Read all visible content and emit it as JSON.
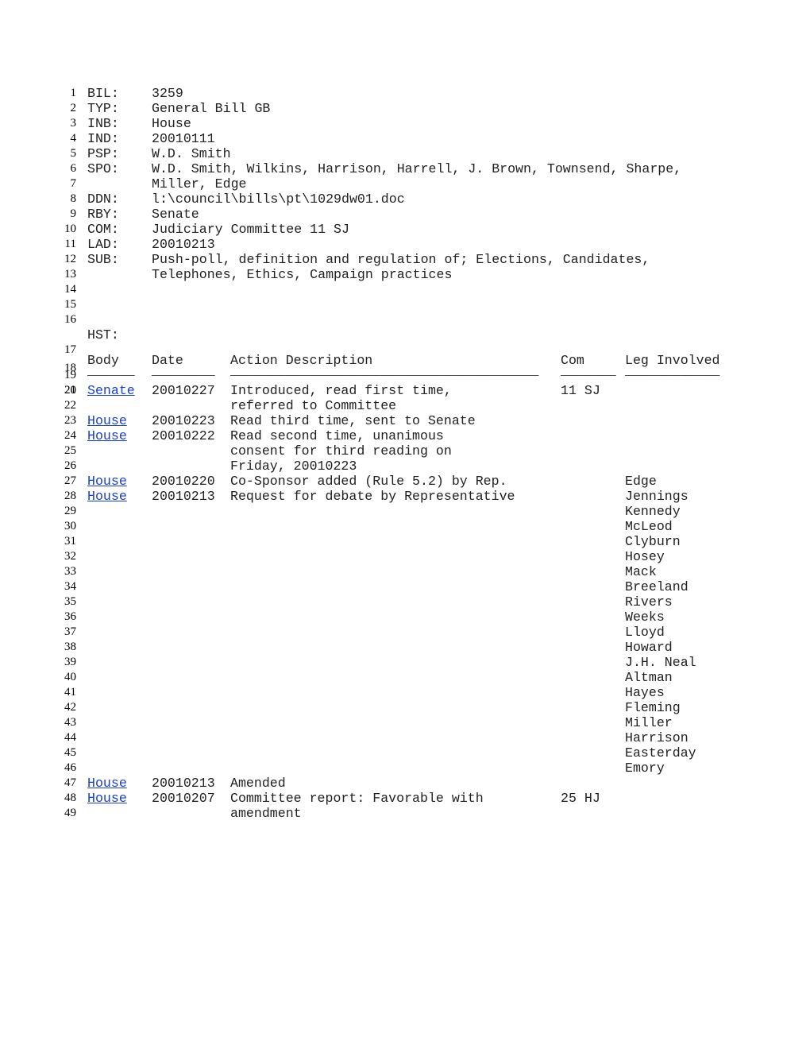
{
  "header_fields": [
    {
      "line": "1",
      "key": "BIL:",
      "value": "3259"
    },
    {
      "line": "2",
      "key": "TYP:",
      "value": "General Bill GB"
    },
    {
      "line": "3",
      "key": "INB:",
      "value": "House"
    },
    {
      "line": "4",
      "key": "IND:",
      "value": "20010111"
    },
    {
      "line": "5",
      "key": "PSP:",
      "value": "W.D. Smith"
    },
    {
      "line": "6",
      "key": "SPO:",
      "value": "W.D. Smith, Wilkins, Harrison, Harrell, J. Brown, Townsend, Sharpe,"
    },
    {
      "line": "7",
      "key": "",
      "value": "Miller, Edge"
    },
    {
      "line": "8",
      "key": "DDN:",
      "value": "l:\\council\\bills\\pt\\1029dw01.doc"
    },
    {
      "line": "9",
      "key": "RBY:",
      "value": "Senate"
    },
    {
      "line": "10",
      "key": "COM:",
      "value": "Judiciary Committee 11 SJ"
    },
    {
      "line": "11",
      "key": "LAD:",
      "value": "20010213"
    },
    {
      "line": "12",
      "key": "SUB:",
      "value": "Push-poll, definition and regulation of; Elections, Candidates,"
    },
    {
      "line": "13",
      "key": "",
      "value": "Telephones, Ethics, Campaign practices"
    }
  ],
  "blank_lines": [
    "14",
    "15",
    "16"
  ],
  "hst": {
    "line": "17",
    "label": "HST:"
  },
  "blank_line_18": "18",
  "history_header": {
    "line": "19",
    "body": "Body",
    "date": "Date",
    "action": "Action Description",
    "com": "Com",
    "leg": "Leg Involved"
  },
  "separator": {
    "line": "20",
    "body": "______",
    "date": "________",
    "action": "_______________________________________",
    "com": "_______",
    "leg": "____________"
  },
  "history_rows": [
    {
      "line": "21",
      "body": "Senate",
      "date": "20010227",
      "action": "Introduced, read first time,",
      "com": "11 SJ",
      "leg": ""
    },
    {
      "line": "22",
      "body": "",
      "date": "",
      "action": "referred to Committee",
      "com": "",
      "leg": ""
    },
    {
      "line": "23",
      "body": "House",
      "date": "20010223",
      "action": "Read third time, sent to Senate",
      "com": "",
      "leg": ""
    },
    {
      "line": "24",
      "body": "House",
      "date": "20010222",
      "action": "Read second time, unanimous",
      "com": "",
      "leg": ""
    },
    {
      "line": "25",
      "body": "",
      "date": "",
      "action": "consent for third reading on",
      "com": "",
      "leg": ""
    },
    {
      "line": "26",
      "body": "",
      "date": "",
      "action": "Friday, 20010223",
      "com": "",
      "leg": ""
    },
    {
      "line": "27",
      "body": "House",
      "date": "20010220",
      "action": "Co-Sponsor added (Rule 5.2) by Rep.",
      "com": "",
      "leg": "Edge"
    },
    {
      "line": "28",
      "body": "House",
      "date": "20010213",
      "action": "Request for debate by Representative",
      "com": "",
      "leg": "Jennings"
    },
    {
      "line": "29",
      "body": "",
      "date": "",
      "action": "",
      "com": "",
      "leg": "Kennedy"
    },
    {
      "line": "30",
      "body": "",
      "date": "",
      "action": "",
      "com": "",
      "leg": "McLeod"
    },
    {
      "line": "31",
      "body": "",
      "date": "",
      "action": "",
      "com": "",
      "leg": "Clyburn"
    },
    {
      "line": "32",
      "body": "",
      "date": "",
      "action": "",
      "com": "",
      "leg": "Hosey"
    },
    {
      "line": "33",
      "body": "",
      "date": "",
      "action": "",
      "com": "",
      "leg": "Mack"
    },
    {
      "line": "34",
      "body": "",
      "date": "",
      "action": "",
      "com": "",
      "leg": "Breeland"
    },
    {
      "line": "35",
      "body": "",
      "date": "",
      "action": "",
      "com": "",
      "leg": "Rivers"
    },
    {
      "line": "36",
      "body": "",
      "date": "",
      "action": "",
      "com": "",
      "leg": "Weeks"
    },
    {
      "line": "37",
      "body": "",
      "date": "",
      "action": "",
      "com": "",
      "leg": "Lloyd"
    },
    {
      "line": "38",
      "body": "",
      "date": "",
      "action": "",
      "com": "",
      "leg": "Howard"
    },
    {
      "line": "39",
      "body": "",
      "date": "",
      "action": "",
      "com": "",
      "leg": "J.H. Neal"
    },
    {
      "line": "40",
      "body": "",
      "date": "",
      "action": "",
      "com": "",
      "leg": "Altman"
    },
    {
      "line": "41",
      "body": "",
      "date": "",
      "action": "",
      "com": "",
      "leg": "Hayes"
    },
    {
      "line": "42",
      "body": "",
      "date": "",
      "action": "",
      "com": "",
      "leg": "Fleming"
    },
    {
      "line": "43",
      "body": "",
      "date": "",
      "action": "",
      "com": "",
      "leg": "Miller"
    },
    {
      "line": "44",
      "body": "",
      "date": "",
      "action": "",
      "com": "",
      "leg": "Harrison"
    },
    {
      "line": "45",
      "body": "",
      "date": "",
      "action": "",
      "com": "",
      "leg": "Easterday"
    },
    {
      "line": "46",
      "body": "",
      "date": "",
      "action": "",
      "com": "",
      "leg": "Emory"
    },
    {
      "line": "47",
      "body": "House",
      "date": "20010213",
      "action": "Amended",
      "com": "",
      "leg": ""
    },
    {
      "line": "48",
      "body": "House",
      "date": "20010207",
      "action": "Committee report: Favorable with",
      "com": "25 HJ",
      "leg": ""
    },
    {
      "line": "49",
      "body": "",
      "date": "",
      "action": "amendment",
      "com": "",
      "leg": ""
    }
  ],
  "colors": {
    "link": "#1a3fd8",
    "text": "#222222"
  }
}
